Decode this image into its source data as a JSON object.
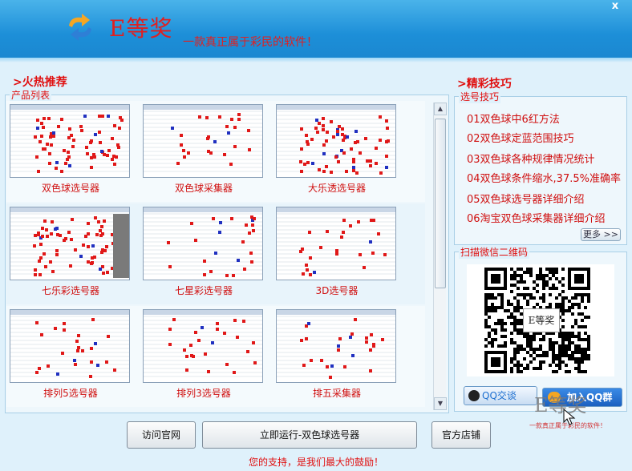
{
  "window": {
    "close_label": "x"
  },
  "header": {
    "brand": "E等奖",
    "slogan": "一款真正属于彩民的软件！"
  },
  "sections": {
    "hot": ">火热推荐",
    "tips": ">精彩技巧"
  },
  "product_panel": {
    "legend": "产品列表"
  },
  "products": [
    {
      "caption": "双色球选号器"
    },
    {
      "caption": "双色球采集器"
    },
    {
      "caption": "大乐透选号器"
    },
    {
      "caption": "七乐彩选号器"
    },
    {
      "caption": "七星彩选号器"
    },
    {
      "caption": "3D选号器"
    },
    {
      "caption": "排列5选号器"
    },
    {
      "caption": "排列3选号器"
    },
    {
      "caption": "排五采集器"
    }
  ],
  "tips_panel": {
    "legend": "选号技巧",
    "items": [
      "01双色球中6红方法",
      "02双色球定蓝范围技巧",
      "03双色球各种规律情况统计",
      "04双色球条件缩水,37.5%准确率",
      "05双色球选号器详细介绍",
      "06淘宝双色球采集器详细介绍"
    ],
    "more": "更多 >>"
  },
  "qr_panel": {
    "legend": "扫描微信二维码",
    "qr_brand": "E等奖"
  },
  "qq": {
    "chat_label": "QQ交谈",
    "join_label": "加入QQ群"
  },
  "watermark": {
    "brand": "E等奖",
    "slogan": "一款真正属于彩民的软件！"
  },
  "buttons": {
    "visit": "访问官网",
    "run": "立即运行-双色球选号器",
    "shop": "官方店铺"
  },
  "footer": "您的支持，是我们最大的鼓励！",
  "colors": {
    "accent_red": "#e01010",
    "header_blue": "#1d8fd8",
    "qq_blue": "#1d6fd0"
  }
}
